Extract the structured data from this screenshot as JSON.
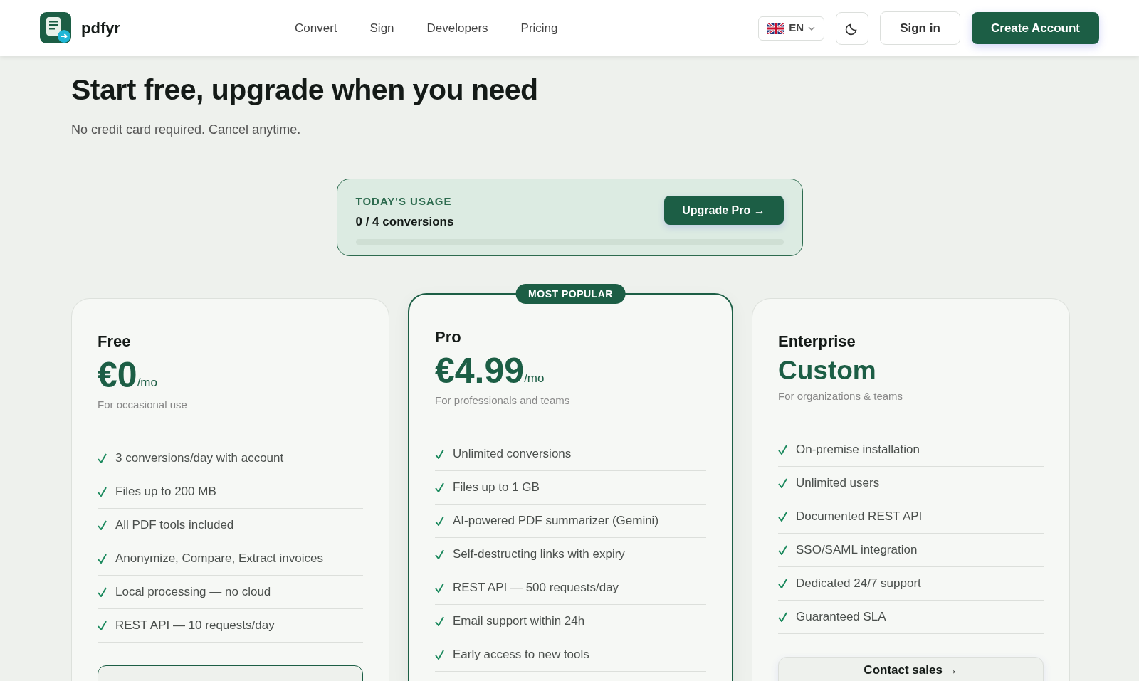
{
  "header": {
    "brand": "pdfyr",
    "nav": [
      {
        "label": "Convert"
      },
      {
        "label": "Sign"
      },
      {
        "label": "Developers"
      },
      {
        "label": "Pricing"
      }
    ],
    "language": "EN",
    "sign_in": "Sign in",
    "create_account": "Create Account"
  },
  "hero": {
    "title": "Start free, upgrade when you need",
    "subtitle": "No credit card required. Cancel anytime."
  },
  "usage": {
    "label": "TODAY'S USAGE",
    "count": "0 / 4 conversions",
    "level": 0,
    "button": "Upgrade Pro →"
  },
  "plans": [
    {
      "name": "Free",
      "price": "€0",
      "period": "/mo",
      "subtitle": "For occasional use",
      "featured": false,
      "features": [
        "3 conversions/day with account",
        "Files up to 200 MB",
        "All PDF tools included",
        "Anonymize, Compare, Extract invoices",
        "Local processing — no cloud",
        "REST API — 10 requests/day"
      ],
      "cta": {
        "kind": "outline"
      }
    },
    {
      "name": "Pro",
      "badge": "MOST POPULAR",
      "price": "€4.99",
      "period": "/mo",
      "subtitle": "For professionals and teams",
      "featured": true,
      "features": [
        "Unlimited conversions",
        "Files up to 1 GB",
        "AI-powered PDF summarizer (Gemini)",
        "Self-destructing links with expiry",
        "REST API — 500 requests/day",
        "Email support within 24h",
        "Early access to new tools"
      ]
    },
    {
      "name": "Enterprise",
      "price": "Custom",
      "subtitle": "For organizations & teams",
      "featured": false,
      "features": [
        "On-premise installation",
        "Unlimited users",
        "Documented REST API",
        "SSO/SAML integration",
        "Dedicated 24/7 support",
        "Guaranteed SLA"
      ],
      "cta": {
        "kind": "soft",
        "label": "Contact sales →"
      }
    }
  ]
}
